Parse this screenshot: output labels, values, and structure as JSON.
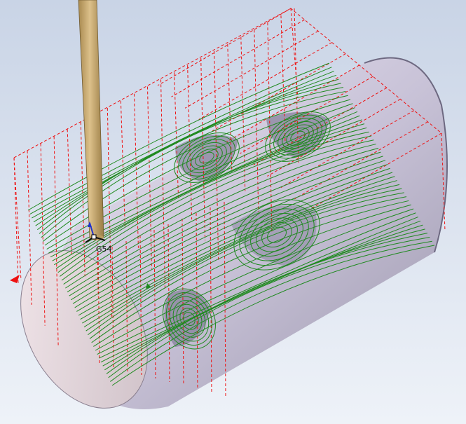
{
  "viewport": {
    "background_top": "#c9d4e6",
    "background_bottom": "#eef2f8",
    "stock_color": "#c8c2d6",
    "cut_toolpath_color": "#1f8a1f",
    "rapid_toolpath_color": "#ee1111",
    "tool_shank_color": "#c8a96a"
  },
  "wcs": {
    "label": "G54"
  }
}
